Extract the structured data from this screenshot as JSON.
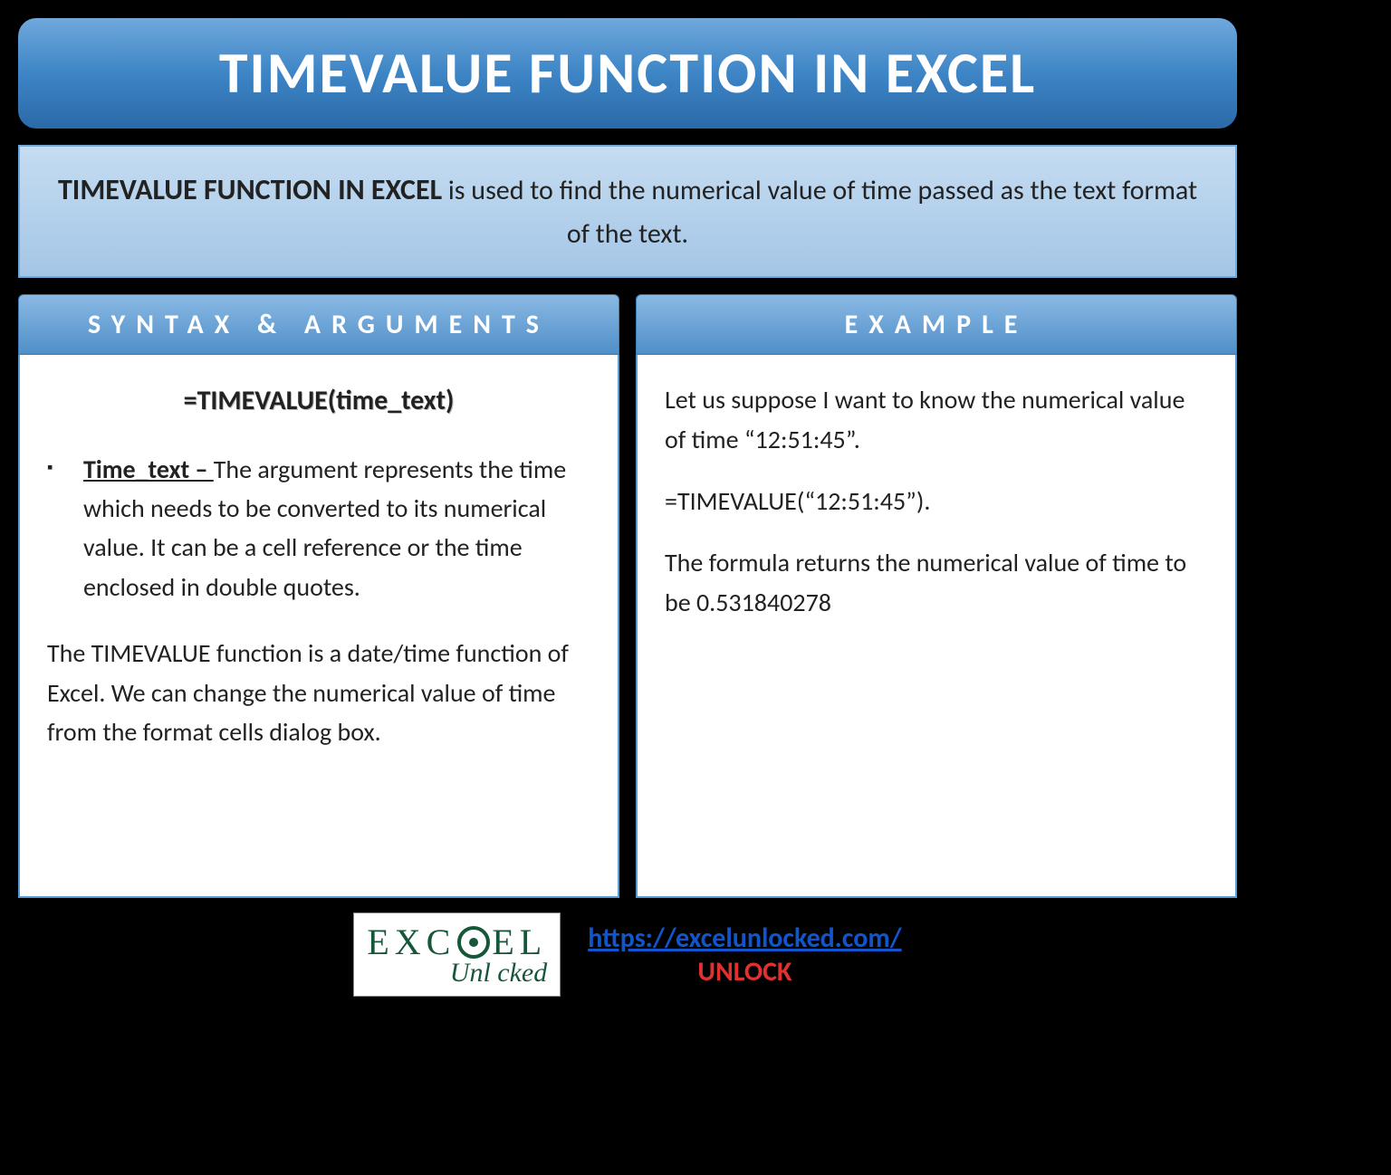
{
  "title": "TIMEVALUE FUNCTION IN EXCEL",
  "description_bold": "TIMEVALUE FUNCTION IN EXCEL",
  "description_rest": " is used to find the numerical value of time passed as the text format of the text.",
  "syntax": {
    "header": "SYNTAX & ARGUMENTS",
    "formula": "=TIMEVALUE(time_text)",
    "arg_name": "Time_text – ",
    "arg_desc": "The argument represents the time which needs to be converted to its numerical value. It can be a cell reference or the time enclosed in double quotes.",
    "note": "The TIMEVALUE function is a date/time function of Excel. We can change the numerical value of time from the format cells dialog box."
  },
  "example": {
    "header": "EXAMPLE",
    "p1": "Let us suppose I want to know the numerical value of time “12:51:45”.",
    "p2": "=TIMEVALUE(“12:51:45”).",
    "p3": "The formula returns the numerical value of time to be 0.531840278"
  },
  "footer": {
    "logo_top_pre": "EXC",
    "logo_top_post": "EL",
    "logo_bottom": "Unl   cked",
    "url": "https://excelunlocked.com/",
    "unlock": "UNLOCK"
  }
}
